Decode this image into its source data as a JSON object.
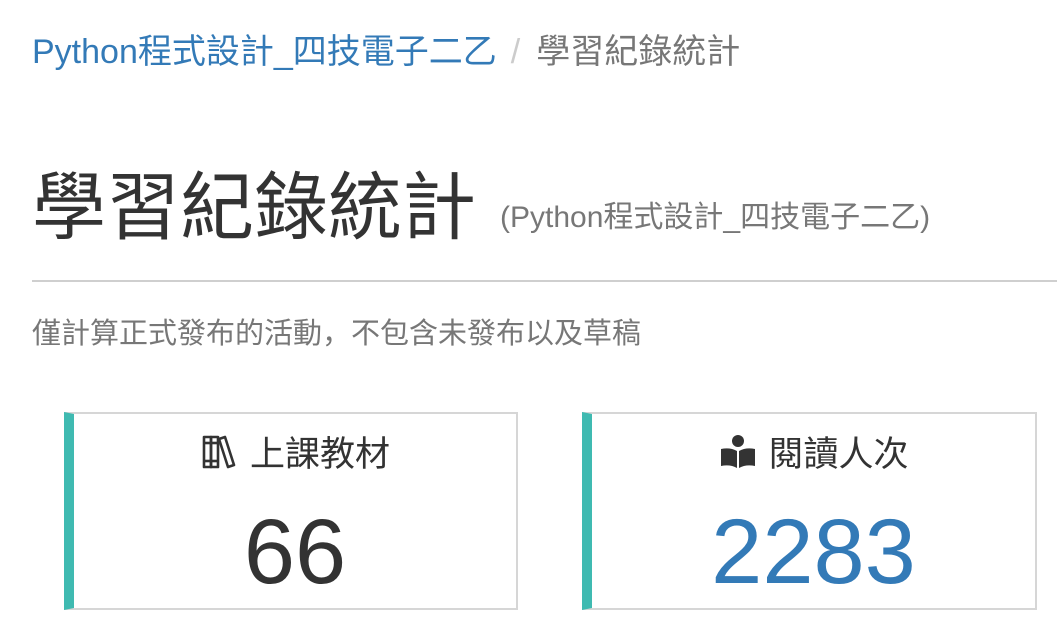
{
  "breadcrumb": {
    "course_link": "Python程式設計_四技電子二乙",
    "separator": "/",
    "current": "學習紀錄統計"
  },
  "header": {
    "title": "學習紀錄統計",
    "subtitle": "(Python程式設計_四技電子二乙)"
  },
  "note": "僅計算正式發布的活動，不包含未發布以及草稿",
  "cards": [
    {
      "icon": "books-icon",
      "label": "上課教材",
      "value": "66",
      "value_color": "#333333"
    },
    {
      "icon": "reader-icon",
      "label": "閱讀人次",
      "value": "2283",
      "value_color": "#337ab7"
    }
  ],
  "colors": {
    "accent": "#3fbab1",
    "link": "#337ab7",
    "muted": "#777777"
  }
}
